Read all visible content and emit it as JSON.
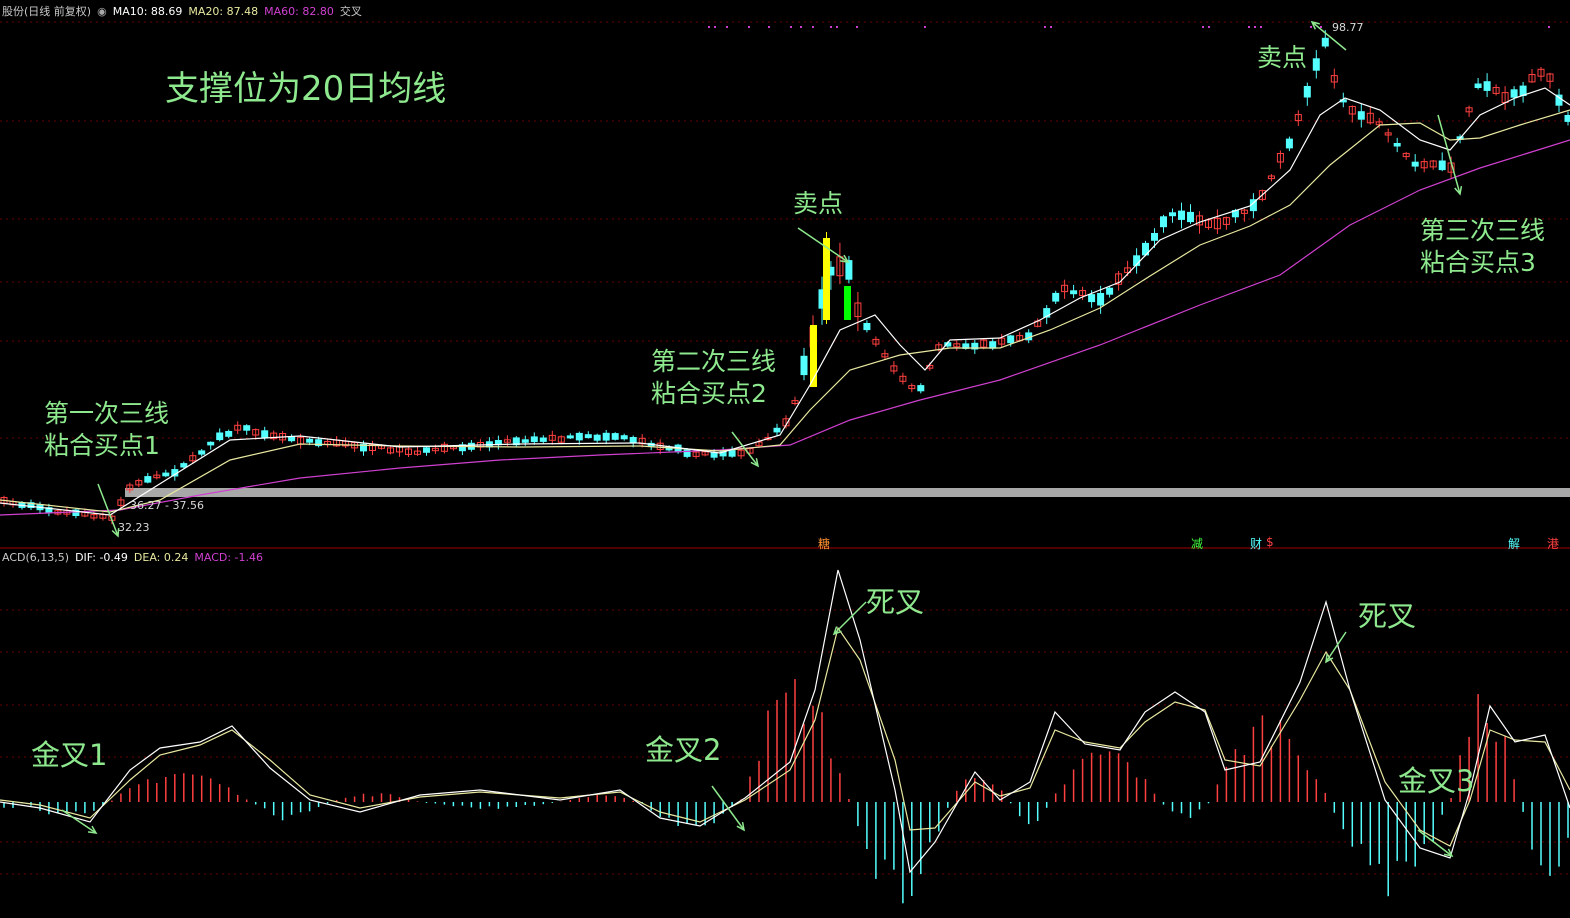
{
  "price_header": {
    "stock_label": "股份(日线 前复权)",
    "ma10_label": "MA10: 88.69",
    "ma20_label": "MA20: 87.48",
    "ma60_label": "MA60: 82.80",
    "extra_label": "交叉"
  },
  "macd_header": {
    "name_label": "ACD(6,13,5)",
    "dif_label": "DIF: -0.49",
    "dea_label": "DEA: 0.24",
    "macd_label": "MACD: -1.46"
  },
  "annotations": {
    "support_title": "支撑位为20日均线",
    "buy1": "第一次三线\n粘合买点1",
    "buy2": "第二次三线\n粘合买点2",
    "buy3": "第三次三线\n粘合买点3",
    "sell1": "卖点",
    "sell2": "卖点",
    "golden1": "金叉1",
    "golden2": "金叉2",
    "golden3": "金叉3",
    "death1": "死叉",
    "death2": "死叉"
  },
  "price_labels": {
    "low_price": "32.23",
    "range_price": "36.27 - 37.56",
    "high_price": "98.77"
  },
  "event_markers": [
    "糖",
    "减",
    "财",
    "$",
    "解",
    "港"
  ],
  "colors": {
    "background": "#000000",
    "up": "#ff4040",
    "down": "#54ffff",
    "ma10": "#ffffff",
    "ma20": "#e8e8a0",
    "ma60": "#d040d0",
    "support_bar": "#a8a8a8",
    "annotation": "#8ee88e",
    "highlight_up": "#ffff00",
    "highlight_down": "#00ff00",
    "grid": "#6a0000"
  },
  "chart_data": [
    {
      "type": "candlestick",
      "title": "股份(日线 前复权)",
      "series": [
        {
          "name": "MA10",
          "last_value": 88.69
        },
        {
          "name": "MA20",
          "last_value": 87.48
        },
        {
          "name": "MA60",
          "last_value": 82.8
        }
      ],
      "price_range": [
        32.23,
        98.77
      ],
      "support_level": 36.5,
      "grid": true
    },
    {
      "type": "bar",
      "title": "ACD(6,13,5)",
      "series": [
        {
          "name": "DIF",
          "last_value": -0.49
        },
        {
          "name": "DEA",
          "last_value": 0.24
        },
        {
          "name": "MACD",
          "last_value": -1.46
        }
      ],
      "grid": true
    }
  ]
}
